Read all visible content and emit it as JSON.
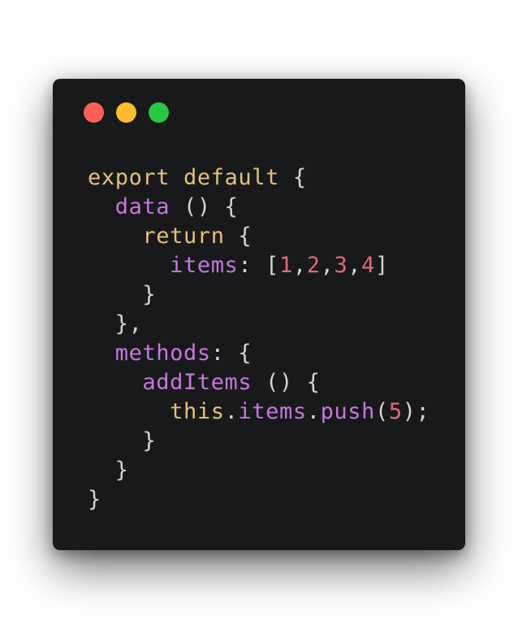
{
  "window": {
    "controls": [
      {
        "name": "close",
        "color": "#ff5f57"
      },
      {
        "name": "minimize",
        "color": "#febc2e"
      },
      {
        "name": "zoom",
        "color": "#28c840"
      }
    ]
  },
  "code": {
    "lines": [
      {
        "indent": "",
        "tokens": [
          {
            "t": "export default",
            "c": "kw"
          },
          {
            "t": " {",
            "c": "punc"
          }
        ]
      },
      {
        "indent": "  ",
        "tokens": [
          {
            "t": "data",
            "c": "prop"
          },
          {
            "t": " () {",
            "c": "punc"
          }
        ]
      },
      {
        "indent": "    ",
        "tokens": [
          {
            "t": "return",
            "c": "kw"
          },
          {
            "t": " {",
            "c": "punc"
          }
        ]
      },
      {
        "indent": "      ",
        "tokens": [
          {
            "t": "items",
            "c": "prop"
          },
          {
            "t": ": [",
            "c": "punc"
          },
          {
            "t": "1",
            "c": "num"
          },
          {
            "t": ",",
            "c": "punc"
          },
          {
            "t": "2",
            "c": "num"
          },
          {
            "t": ",",
            "c": "punc"
          },
          {
            "t": "3",
            "c": "num"
          },
          {
            "t": ",",
            "c": "punc"
          },
          {
            "t": "4",
            "c": "num"
          },
          {
            "t": "]",
            "c": "punc"
          }
        ]
      },
      {
        "indent": "    ",
        "tokens": [
          {
            "t": "}",
            "c": "punc"
          }
        ]
      },
      {
        "indent": "  ",
        "tokens": [
          {
            "t": "},",
            "c": "punc"
          }
        ]
      },
      {
        "indent": "  ",
        "tokens": [
          {
            "t": "methods",
            "c": "prop"
          },
          {
            "t": ": {",
            "c": "punc"
          }
        ]
      },
      {
        "indent": "    ",
        "tokens": [
          {
            "t": "addItems",
            "c": "fn"
          },
          {
            "t": " () {",
            "c": "punc"
          }
        ]
      },
      {
        "indent": "      ",
        "tokens": [
          {
            "t": "this",
            "c": "this"
          },
          {
            "t": ".",
            "c": "punc"
          },
          {
            "t": "items",
            "c": "prop"
          },
          {
            "t": ".",
            "c": "punc"
          },
          {
            "t": "push",
            "c": "fn"
          },
          {
            "t": "(",
            "c": "punc"
          },
          {
            "t": "5",
            "c": "num"
          },
          {
            "t": ");",
            "c": "punc"
          }
        ]
      },
      {
        "indent": "    ",
        "tokens": [
          {
            "t": "}",
            "c": "punc"
          }
        ]
      },
      {
        "indent": "  ",
        "tokens": [
          {
            "t": "}",
            "c": "punc"
          }
        ]
      },
      {
        "indent": "",
        "tokens": [
          {
            "t": "}",
            "c": "punc"
          }
        ]
      }
    ]
  }
}
